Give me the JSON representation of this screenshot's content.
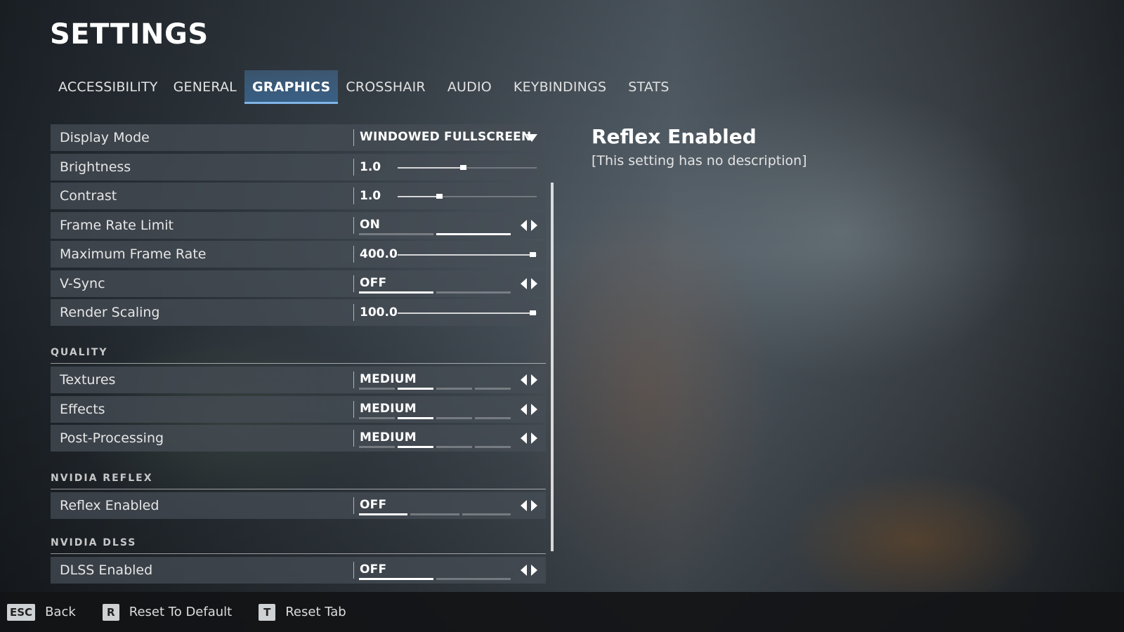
{
  "page_title": "SETTINGS",
  "tabs": [
    {
      "label": "ACCESSIBILITY",
      "active": false
    },
    {
      "label": "GENERAL",
      "active": false
    },
    {
      "label": "GRAPHICS",
      "active": true
    },
    {
      "label": "CROSSHAIR",
      "active": false
    },
    {
      "label": "AUDIO",
      "active": false
    },
    {
      "label": "KEYBINDINGS",
      "active": false
    },
    {
      "label": "STATS",
      "active": false
    }
  ],
  "display": {
    "display_mode": {
      "label": "Display Mode",
      "value": "WINDOWED FULLSCREEN"
    },
    "brightness": {
      "label": "Brightness",
      "value": "1.0",
      "fraction": 0.47
    },
    "contrast": {
      "label": "Contrast",
      "value": "1.0",
      "fraction": 0.3
    },
    "frame_rate_limit": {
      "label": "Frame Rate Limit",
      "value": "ON",
      "segments": 2,
      "selected": 1
    },
    "max_frame_rate": {
      "label": "Maximum Frame Rate",
      "value": "400.0",
      "fraction": 0.97
    },
    "vsync": {
      "label": "V-Sync",
      "value": "OFF",
      "segments": 2,
      "selected": 0
    },
    "render_scaling": {
      "label": "Render Scaling",
      "value": "100.0",
      "fraction": 0.97
    }
  },
  "quality": {
    "title": "QUALITY",
    "textures": {
      "label": "Textures",
      "value": "MEDIUM",
      "segments": 4,
      "selected": 1
    },
    "effects": {
      "label": "Effects",
      "value": "MEDIUM",
      "segments": 4,
      "selected": 1
    },
    "post_processing": {
      "label": "Post-Processing",
      "value": "MEDIUM",
      "segments": 4,
      "selected": 1
    }
  },
  "reflex": {
    "title": "NVIDIA REFLEX",
    "enabled": {
      "label": "Reflex Enabled",
      "value": "OFF",
      "segments": 3,
      "selected": 0
    }
  },
  "dlss": {
    "title": "NVIDIA DLSS",
    "enabled": {
      "label": "DLSS Enabled",
      "value": "OFF",
      "segments": 2,
      "selected": 0
    }
  },
  "description": {
    "title": "Reflex Enabled",
    "text": "[This setting has no description]"
  },
  "footer": {
    "back": {
      "key": "ESC",
      "label": "Back"
    },
    "reset_default": {
      "key": "R",
      "label": "Reset To Default"
    },
    "reset_tab": {
      "key": "T",
      "label": "Reset Tab"
    }
  }
}
